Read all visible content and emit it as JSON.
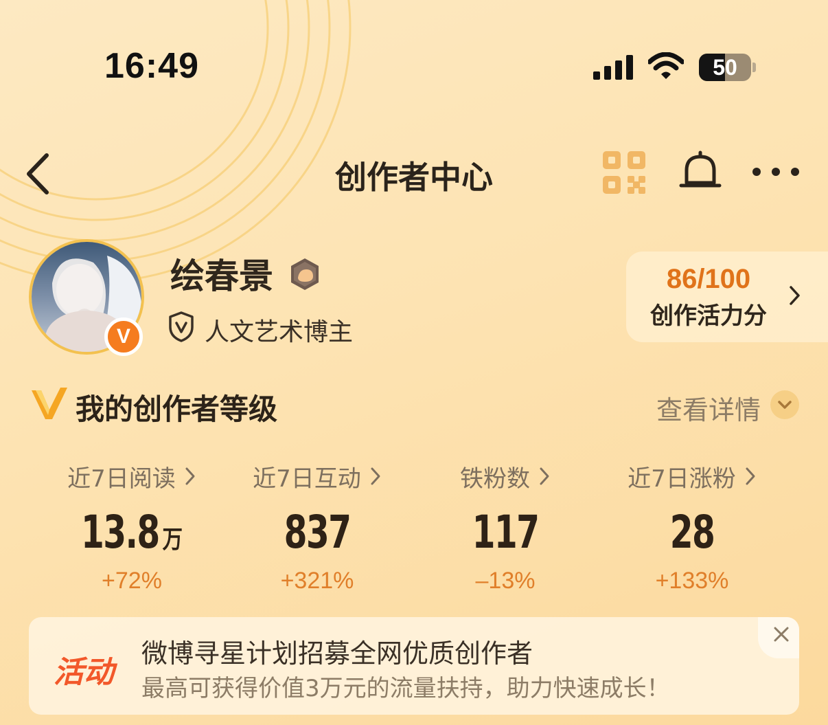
{
  "status_bar": {
    "time": "16:49",
    "battery": "50",
    "battery_level": 0.5
  },
  "nav": {
    "title": "创作者中心"
  },
  "profile": {
    "username": "绘春景",
    "verification": "人文艺术博主",
    "badge_letter": "V"
  },
  "score": {
    "value": "86/100",
    "label": "创作活力分"
  },
  "level": {
    "title": "我的创作者等级",
    "detail_link": "查看详情"
  },
  "stats": [
    {
      "label": "近7日阅读",
      "value": "13.8",
      "unit": "万",
      "change": "+72%"
    },
    {
      "label": "近7日互动",
      "value": "837",
      "unit": "",
      "change": "+321%"
    },
    {
      "label": "铁粉数",
      "value": "117",
      "unit": "",
      "change": "–13%"
    },
    {
      "label": "近7日涨粉",
      "value": "28",
      "unit": "",
      "change": "+133%"
    }
  ],
  "banner": {
    "tag": "活动",
    "title": "微博寻星计划招募全网优质创作者",
    "subtitle": "最高可获得价值3万元的流量扶持，助力快速成长！"
  },
  "colors": {
    "accent": "#e0731a",
    "verified_badge": "#f57c1f",
    "activity_tag": "#f2582a",
    "background": "#fde3b2"
  },
  "icons": [
    "back-icon",
    "qr-code-icon",
    "bell-icon",
    "more-icon",
    "signal-icon",
    "wifi-icon",
    "battery-icon",
    "shield-v-icon",
    "v-logo-icon",
    "chevron-right-icon",
    "chevron-down-icon",
    "close-icon"
  ]
}
